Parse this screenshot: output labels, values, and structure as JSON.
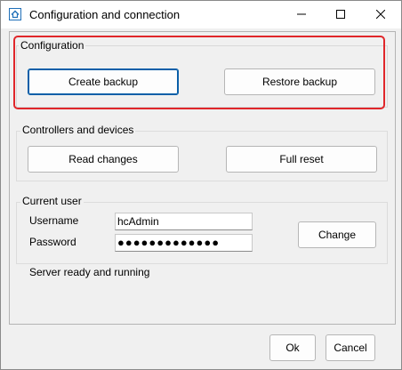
{
  "window": {
    "title": "Configuration and connection",
    "icon": "home-icon"
  },
  "titlebar_buttons": {
    "minimize": "minimize-icon",
    "maximize": "maximize-icon",
    "close": "close-icon"
  },
  "configuration": {
    "title": "Configuration",
    "create_backup_label": "Create backup",
    "restore_backup_label": "Restore backup"
  },
  "controllers": {
    "title": "Controllers and devices",
    "read_changes_label": "Read changes",
    "full_reset_label": "Full reset"
  },
  "current_user": {
    "title": "Current user",
    "username_label": "Username",
    "username_value": "hcAdmin",
    "password_label": "Password",
    "password_value": "●●●●●●●●●●●●●",
    "change_label": "Change"
  },
  "status": {
    "text": "Server ready and running"
  },
  "footer": {
    "ok_label": "Ok",
    "cancel_label": "Cancel"
  },
  "colors": {
    "highlight": "#e0262a",
    "focus_border": "#0a5fa8",
    "client_background": "#f0f0f0"
  }
}
